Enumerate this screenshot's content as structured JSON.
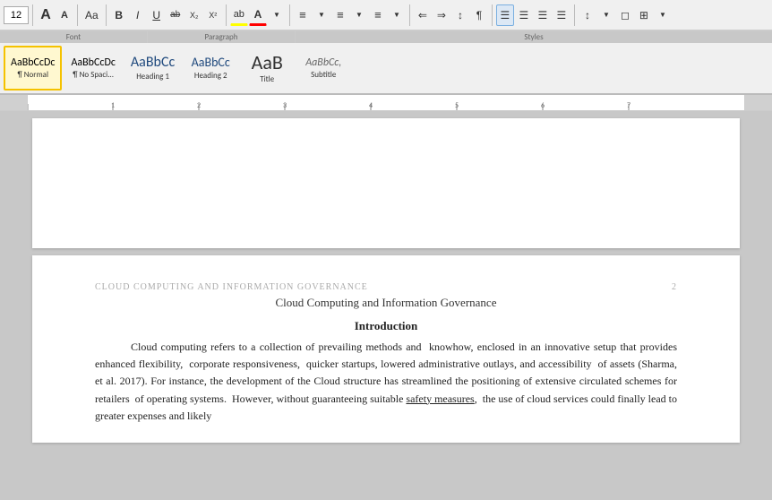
{
  "toolbar": {
    "font_size": "12",
    "grow_icon": "A",
    "shrink_icon": "A",
    "clear_format": "Aa",
    "bold": "B",
    "italic": "I",
    "underline": "U",
    "strikethrough": "ab",
    "subscript": "X₂",
    "superscript": "X²",
    "text_color": "A",
    "highlight": "ab",
    "font_label": "Font",
    "paragraph_label": "Paragraph",
    "styles_label": "Styles"
  },
  "paragraph": {
    "bullets": "≡",
    "numbering": "≡",
    "multilevel": "≡",
    "decrease_indent": "⇐",
    "increase_indent": "⇒",
    "sort": "↕",
    "show_marks": "¶",
    "align_left": "≡",
    "align_center": "≡",
    "align_right": "≡",
    "justify": "≡",
    "line_spacing": "≡",
    "shading": "◻",
    "borders": "⊞"
  },
  "styles": [
    {
      "id": "normal",
      "preview": "AaBbCcDc",
      "label": "Normal",
      "selected": true
    },
    {
      "id": "no-spacing",
      "preview": "AaBbCcDc",
      "label": "No Spaci...",
      "selected": false
    },
    {
      "id": "heading1",
      "preview": "AaBbCc",
      "label": "Heading 1",
      "selected": false
    },
    {
      "id": "heading2",
      "preview": "AaBbCc",
      "label": "Heading 2",
      "selected": false
    },
    {
      "id": "title",
      "preview": "AaB",
      "label": "Title",
      "selected": false
    },
    {
      "id": "subtitle",
      "preview": "AaBbCc,",
      "label": "Subtitle",
      "selected": false
    }
  ],
  "document": {
    "page_header": "CLOUD COMPUTING AND INFORMATION GOVERNANCE",
    "page_number": "2",
    "title": "Cloud Computing and Information Governance",
    "intro_heading": "Introduction",
    "body_text": "Cloud computing refers to a collection of prevailing methods and  knowhow, enclosed in an innovative setup that provides enhanced flexibility,  corporate responsiveness,  quicker startups, lowered administrative outlays, and accessibility  of assets (Sharma, et al. 2017). For instance, the development of the Cloud structure has streamlined the positioning of extensive circulated schemes for retailers  of operating systems.  However, without guaranteeing suitable safety measures,  the use of cloud services could finally lead to greater expenses and likely"
  },
  "ruler": {
    "visible": true
  }
}
